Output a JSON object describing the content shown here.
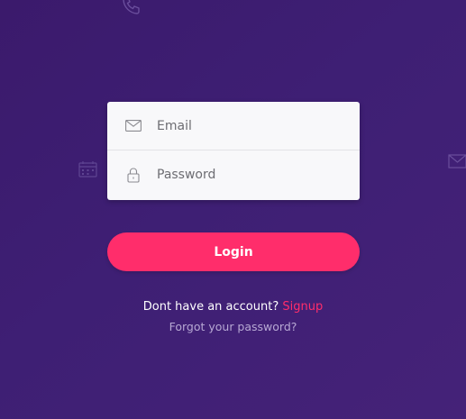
{
  "form": {
    "email_placeholder": "Email",
    "password_placeholder": "Password",
    "login_label": "Login"
  },
  "footer": {
    "signup_prompt": "Dont have an account?",
    "signup_link": "Signup",
    "forgot_password": "Forgot your password?"
  },
  "icons": {
    "email_field": "envelope-icon",
    "password_field": "lock-icon",
    "background": [
      "phone-icon",
      "calendar-icon",
      "envelope-icon"
    ]
  },
  "colors": {
    "background": "#3e1f74",
    "accent": "#ff2d6b",
    "card": "#f8f8fa",
    "muted_link": "#b7a8d4"
  }
}
